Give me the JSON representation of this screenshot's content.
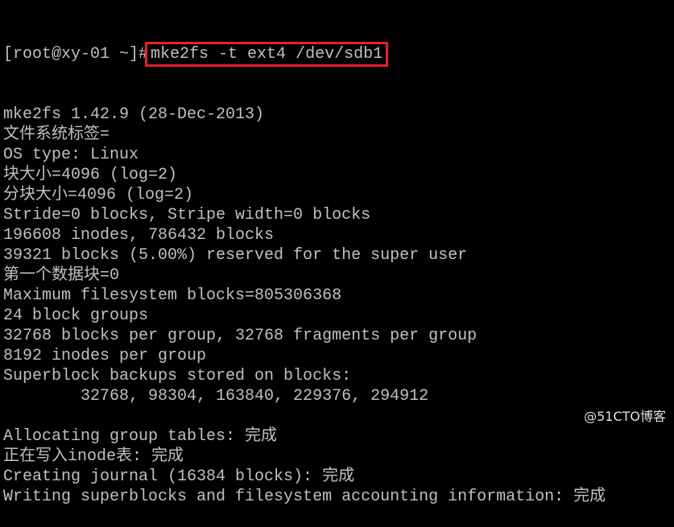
{
  "terminal": {
    "prompt": "[root@xy-01 ~]#",
    "command": "mke2fs -t ext4 /dev/sdb1",
    "highlight_color": "#e8202a",
    "output": [
      "mke2fs 1.42.9 (28-Dec-2013)",
      "文件系统标签=",
      "OS type: Linux",
      "块大小=4096 (log=2)",
      "分块大小=4096 (log=2)",
      "Stride=0 blocks, Stripe width=0 blocks",
      "196608 inodes, 786432 blocks",
      "39321 blocks (5.00%) reserved for the super user",
      "第一个数据块=0",
      "Maximum filesystem blocks=805306368",
      "24 block groups",
      "32768 blocks per group, 32768 fragments per group",
      "8192 inodes per group",
      "Superblock backups stored on blocks:",
      "        32768, 98304, 163840, 229376, 294912",
      "",
      "Allocating group tables: 完成",
      "正在写入inode表: 完成",
      "Creating journal (16384 blocks): 完成",
      "Writing superblocks and filesystem accounting information: 完成"
    ]
  },
  "watermark": "@51CTO博客"
}
